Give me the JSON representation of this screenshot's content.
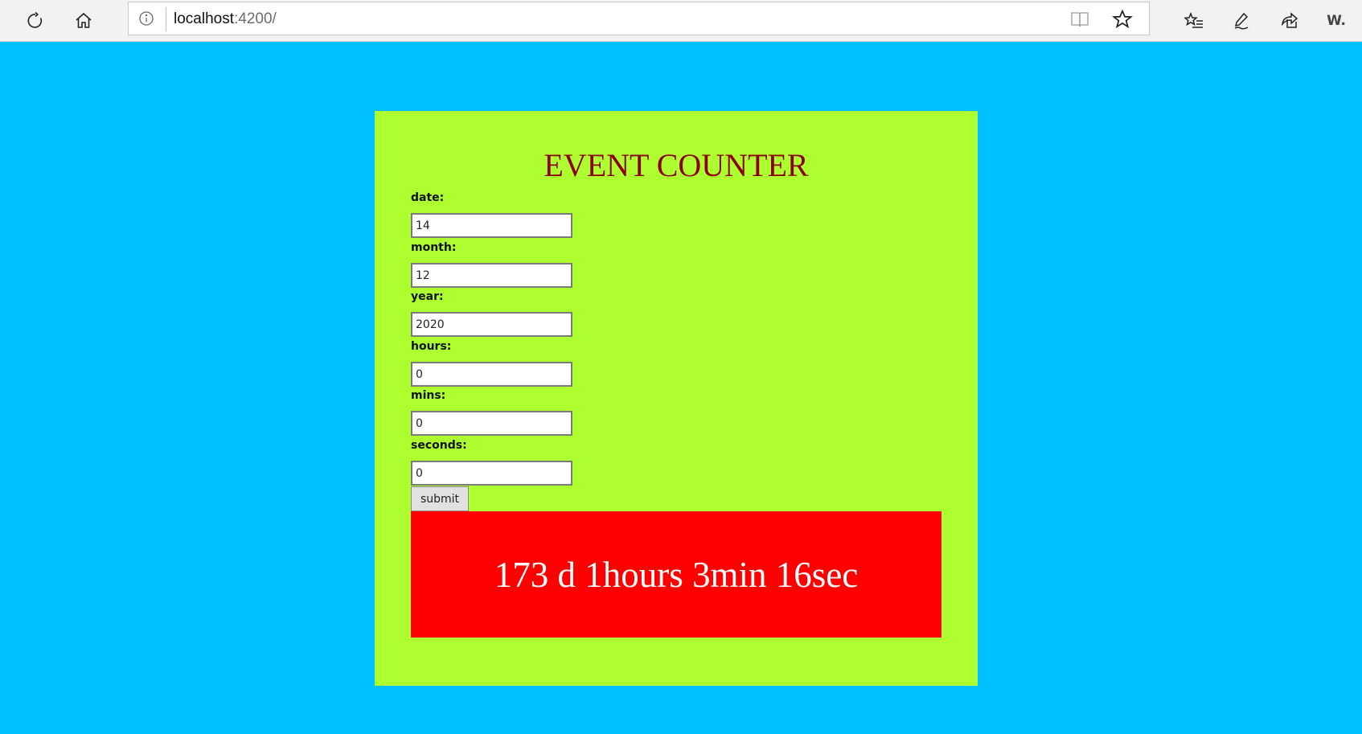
{
  "browser": {
    "url_host": "localhost",
    "url_port": ":4200/",
    "extension_label": "W."
  },
  "icons": {
    "refresh": "refresh-icon",
    "home": "home-icon",
    "info": "info-icon",
    "reading_view": "book-icon",
    "favorite": "star-icon",
    "favorites_list": "favorites-list-icon",
    "notes": "pen-icon",
    "share": "share-icon"
  },
  "colors": {
    "page_background": "#00bfff",
    "card_background": "#adff2f",
    "title_color": "#8b0000",
    "result_background": "#ff0000",
    "result_text": "#ffffff"
  },
  "app": {
    "title": "EVENT COUNTER",
    "fields": [
      {
        "label": "date:",
        "value": "14"
      },
      {
        "label": "month:",
        "value": "12"
      },
      {
        "label": "year:",
        "value": "2020"
      },
      {
        "label": "hours:",
        "value": "0"
      },
      {
        "label": "mins:",
        "value": "0"
      },
      {
        "label": "seconds:",
        "value": "0"
      }
    ],
    "submit_label": "submit",
    "result_text": "173 d 1hours 3min 16sec"
  }
}
